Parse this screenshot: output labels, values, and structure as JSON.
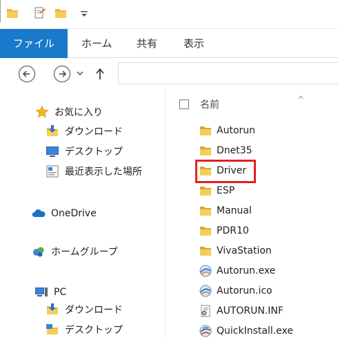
{
  "quick_access": {
    "icons": [
      "folder-icon",
      "properties-icon",
      "new-folder-icon",
      "customize-dropdown-icon"
    ]
  },
  "ribbon": {
    "tabs": [
      {
        "label": "ファイル",
        "active": true
      },
      {
        "label": "ホーム"
      },
      {
        "label": "共有"
      },
      {
        "label": "表示"
      }
    ],
    "active_color": "#1979ca"
  },
  "navigation": {
    "back_icon": "back-arrow-icon",
    "forward_icon": "forward-arrow-icon",
    "recent_icon": "recent-locations-chevron-icon",
    "up_icon": "up-arrow-icon",
    "address_value": ""
  },
  "nav_pane": {
    "favorites": {
      "label": "お気に入り",
      "items": [
        "ダウンロード",
        "デスクトップ",
        "最近表示した場所"
      ]
    },
    "onedrive": "OneDrive",
    "homegroup": "ホームグループ",
    "pc": {
      "label": "PC",
      "items": [
        "ダウンロード",
        "デスクトップ"
      ]
    }
  },
  "file_list": {
    "column_name": "名前",
    "files": [
      {
        "name": "Autorun",
        "icon": "folder-icon"
      },
      {
        "name": "Dnet35",
        "icon": "folder-icon"
      },
      {
        "name": "Driver",
        "icon": "folder-icon",
        "highlighted": true
      },
      {
        "name": "ESP",
        "icon": "folder-icon"
      },
      {
        "name": "Manual",
        "icon": "folder-icon"
      },
      {
        "name": "PDR10",
        "icon": "folder-icon"
      },
      {
        "name": "VivaStation",
        "icon": "folder-icon"
      },
      {
        "name": "Autorun.exe",
        "icon": "app-globe-icon"
      },
      {
        "name": "Autorun.ico",
        "icon": "app-globe-icon"
      },
      {
        "name": "AUTORUN.INF",
        "icon": "settings-file-icon"
      },
      {
        "name": "QuickInstall.exe",
        "icon": "installer-icon"
      }
    ],
    "highlight_color": "#e02020"
  }
}
